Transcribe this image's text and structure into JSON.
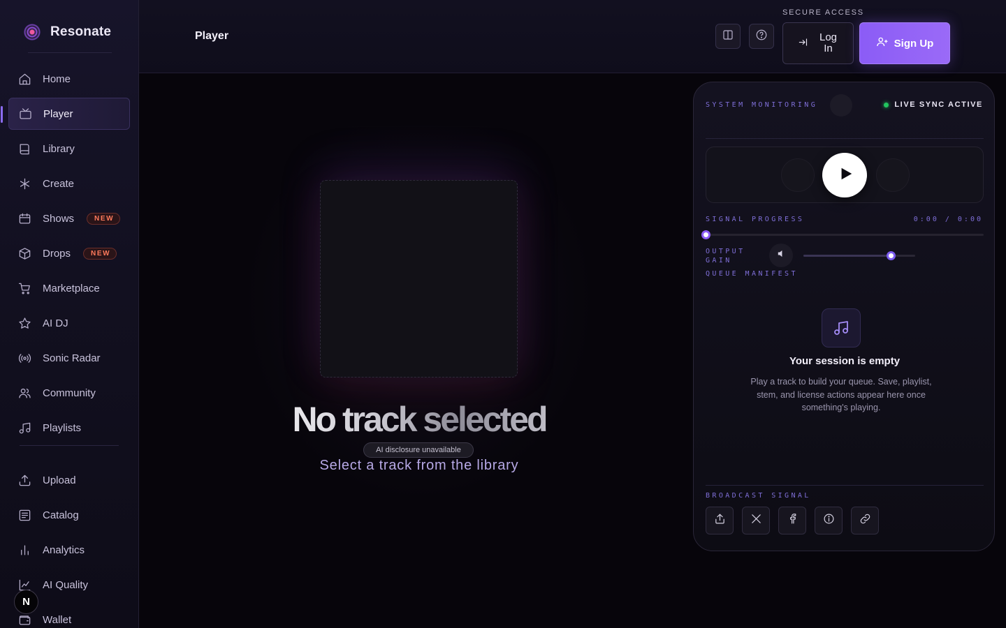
{
  "app": {
    "name": "Resonate"
  },
  "sidebar": {
    "items": [
      {
        "label": "Home",
        "icon": "home-icon"
      },
      {
        "label": "Player",
        "icon": "tv-icon",
        "active": true
      },
      {
        "label": "Library",
        "icon": "book-icon"
      },
      {
        "label": "Create",
        "icon": "asterisk-icon"
      },
      {
        "label": "Shows",
        "icon": "calendar-icon",
        "badge": "NEW"
      },
      {
        "label": "Drops",
        "icon": "package-icon",
        "badge": "NEW"
      },
      {
        "label": "Marketplace",
        "icon": "cart-icon"
      },
      {
        "label": "AI DJ",
        "icon": "star-icon"
      },
      {
        "label": "Sonic Radar",
        "icon": "radar-icon"
      },
      {
        "label": "Community",
        "icon": "users-icon"
      },
      {
        "label": "Playlists",
        "icon": "music-icon"
      }
    ],
    "secondary": [
      {
        "label": "Upload",
        "icon": "upload-icon"
      },
      {
        "label": "Catalog",
        "icon": "list-icon"
      },
      {
        "label": "Analytics",
        "icon": "bar-chart-icon"
      },
      {
        "label": "AI Quality",
        "icon": "line-chart-icon"
      },
      {
        "label": "Wallet",
        "icon": "wallet-icon"
      }
    ],
    "avatar_letter": "N"
  },
  "header": {
    "title": "Player",
    "secure_label": "SECURE ACCESS",
    "login_label": "Log In",
    "signup_label": "Sign Up"
  },
  "stage": {
    "headline": "No track selected",
    "ai_disclosure": "AI disclosure unavailable",
    "hint": "Select a track from the library"
  },
  "panel": {
    "system_monitoring": "SYSTEM MONITORING",
    "live_sync": "LIVE SYNC ACTIVE",
    "signal_progress": "SIGNAL PROGRESS",
    "time_readout": "0:00 / 0:00",
    "progress_fraction": 0,
    "output_gain": "OUTPUT GAIN",
    "volume_fraction": 0.78,
    "queue_manifest": "QUEUE MANIFEST",
    "empty_title": "Your session is empty",
    "empty_desc": "Play a track to build your queue. Save, playlist, stem, and license actions appear here once something's playing.",
    "broadcast_signal": "BROADCAST SIGNAL"
  },
  "colors": {
    "accent": "#8b5cf6",
    "badge": "#ff7a5c",
    "live": "#22c55e",
    "label": "#7f6fd8"
  }
}
